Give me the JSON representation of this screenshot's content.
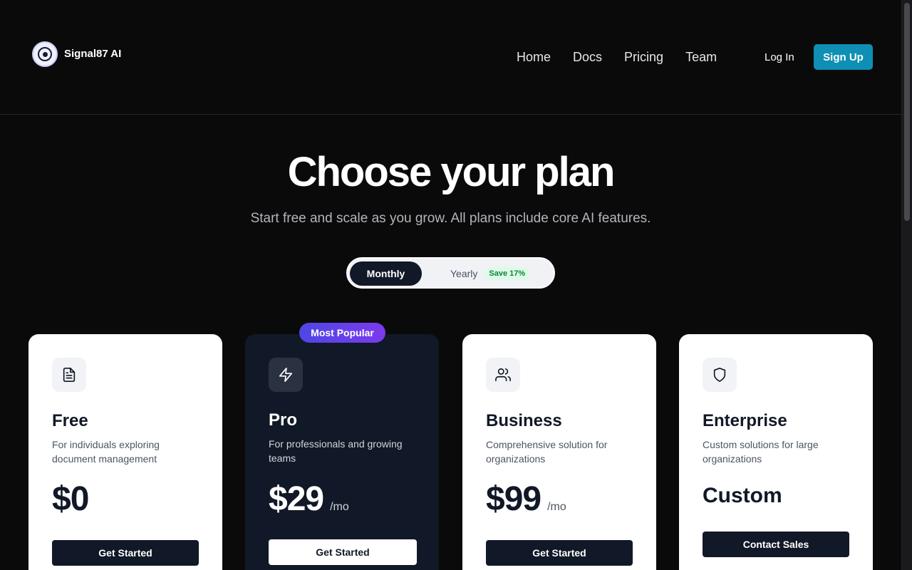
{
  "brand": {
    "name": "Signal87 AI",
    "logo_icon": "target-logo-icon"
  },
  "nav": [
    {
      "label": "Home"
    },
    {
      "label": "Docs"
    },
    {
      "label": "Pricing"
    },
    {
      "label": "Team"
    }
  ],
  "auth": {
    "login_label": "Log In",
    "signup_label": "Sign Up"
  },
  "hero": {
    "title": "Choose your plan",
    "subtitle": "Start free and scale as you grow. All plans include core AI features."
  },
  "billing_toggle": {
    "monthly_label": "Monthly",
    "yearly_label": "Yearly",
    "save_badge": "Save 17%",
    "selected": "Monthly"
  },
  "popular_badge": "Most Popular",
  "plans": [
    {
      "icon": "document-icon",
      "name": "Free",
      "description": "For individuals exploring document management",
      "price": "$0",
      "unit": "",
      "cta": "Get Started"
    },
    {
      "icon": "lightning-icon",
      "name": "Pro",
      "description": "For professionals and growing teams",
      "price": "$29",
      "unit": "/mo",
      "cta": "Get Started"
    },
    {
      "icon": "users-icon",
      "name": "Business",
      "description": "Comprehensive solution for organizations",
      "price": "$99",
      "unit": "/mo",
      "cta": "Get Started"
    },
    {
      "icon": "shield-icon",
      "name": "Enterprise",
      "description": "Custom solutions for large organizations",
      "price": "Custom",
      "unit": "",
      "cta": "Contact Sales"
    }
  ],
  "colors": {
    "background": "#0a0a0b",
    "accent": "#0e8fb3",
    "dark_card": "#111827",
    "popular_gradient_start": "#4f46e5",
    "popular_gradient_end": "#7c3aed"
  }
}
